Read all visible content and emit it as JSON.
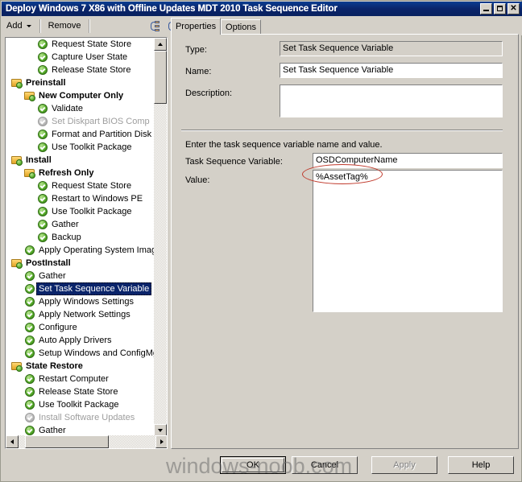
{
  "window": {
    "title": "Deploy Windows 7 X86 with Offline Updates MDT 2010 Task Sequence Editor",
    "minimize_label": "_",
    "maximize_label": "",
    "close_label": "✕"
  },
  "toolbar": {
    "add_label": "Add",
    "remove_label": "Remove",
    "move_up_icon": "move-up-icon",
    "move_down_icon": "move-down-icon"
  },
  "tree": {
    "items": [
      {
        "label": "Request State Store",
        "indent": 2,
        "icon": "check",
        "bold": false,
        "disabled": false,
        "selected": false
      },
      {
        "label": "Capture User State",
        "indent": 2,
        "icon": "check",
        "bold": false,
        "disabled": false,
        "selected": false
      },
      {
        "label": "Release State Store",
        "indent": 2,
        "icon": "check",
        "bold": false,
        "disabled": false,
        "selected": false
      },
      {
        "label": "Preinstall",
        "indent": 0,
        "icon": "folder",
        "bold": true,
        "disabled": false,
        "selected": false
      },
      {
        "label": "New Computer Only",
        "indent": 1,
        "icon": "folder",
        "bold": true,
        "disabled": false,
        "selected": false
      },
      {
        "label": "Validate",
        "indent": 2,
        "icon": "check",
        "bold": false,
        "disabled": false,
        "selected": false
      },
      {
        "label": "Set Diskpart BIOS Comp",
        "indent": 2,
        "icon": "check",
        "bold": false,
        "disabled": true,
        "selected": false
      },
      {
        "label": "Format and Partition Disk",
        "indent": 2,
        "icon": "check",
        "bold": false,
        "disabled": false,
        "selected": false
      },
      {
        "label": "Use Toolkit Package",
        "indent": 2,
        "icon": "check",
        "bold": false,
        "disabled": false,
        "selected": false
      },
      {
        "label": "Install",
        "indent": 0,
        "icon": "folder",
        "bold": true,
        "disabled": false,
        "selected": false
      },
      {
        "label": "Refresh Only",
        "indent": 1,
        "icon": "folder",
        "bold": true,
        "disabled": false,
        "selected": false
      },
      {
        "label": "Request State Store",
        "indent": 2,
        "icon": "check",
        "bold": false,
        "disabled": false,
        "selected": false
      },
      {
        "label": "Restart to Windows PE",
        "indent": 2,
        "icon": "check",
        "bold": false,
        "disabled": false,
        "selected": false
      },
      {
        "label": "Use Toolkit Package",
        "indent": 2,
        "icon": "check",
        "bold": false,
        "disabled": false,
        "selected": false
      },
      {
        "label": "Gather",
        "indent": 2,
        "icon": "check",
        "bold": false,
        "disabled": false,
        "selected": false
      },
      {
        "label": "Backup",
        "indent": 2,
        "icon": "check",
        "bold": false,
        "disabled": false,
        "selected": false
      },
      {
        "label": "Apply Operating System Image",
        "indent": 1,
        "icon": "check",
        "bold": false,
        "disabled": false,
        "selected": false
      },
      {
        "label": "PostInstall",
        "indent": 0,
        "icon": "folder",
        "bold": true,
        "disabled": false,
        "selected": false
      },
      {
        "label": "Gather",
        "indent": 1,
        "icon": "check",
        "bold": false,
        "disabled": false,
        "selected": false
      },
      {
        "label": "Set Task Sequence Variable",
        "indent": 1,
        "icon": "check",
        "bold": false,
        "disabled": false,
        "selected": true
      },
      {
        "label": "Apply Windows Settings",
        "indent": 1,
        "icon": "check",
        "bold": false,
        "disabled": false,
        "selected": false
      },
      {
        "label": "Apply Network Settings",
        "indent": 1,
        "icon": "check",
        "bold": false,
        "disabled": false,
        "selected": false
      },
      {
        "label": "Configure",
        "indent": 1,
        "icon": "check",
        "bold": false,
        "disabled": false,
        "selected": false
      },
      {
        "label": "Auto Apply Drivers",
        "indent": 1,
        "icon": "check",
        "bold": false,
        "disabled": false,
        "selected": false
      },
      {
        "label": "Setup Windows and ConfigMgr",
        "indent": 1,
        "icon": "check",
        "bold": false,
        "disabled": false,
        "selected": false
      },
      {
        "label": "State Restore",
        "indent": 0,
        "icon": "folder",
        "bold": true,
        "disabled": false,
        "selected": false
      },
      {
        "label": "Restart Computer",
        "indent": 1,
        "icon": "check",
        "bold": false,
        "disabled": false,
        "selected": false
      },
      {
        "label": "Release State Store",
        "indent": 1,
        "icon": "check",
        "bold": false,
        "disabled": false,
        "selected": false
      },
      {
        "label": "Use Toolkit Package",
        "indent": 1,
        "icon": "check",
        "bold": false,
        "disabled": false,
        "selected": false
      },
      {
        "label": "Install Software Updates",
        "indent": 1,
        "icon": "check",
        "bold": false,
        "disabled": true,
        "selected": false
      },
      {
        "label": "Gather",
        "indent": 1,
        "icon": "check",
        "bold": false,
        "disabled": false,
        "selected": false
      }
    ]
  },
  "tabs": [
    {
      "label": "Properties",
      "active": true
    },
    {
      "label": "Options",
      "active": false
    }
  ],
  "properties": {
    "type_label": "Type:",
    "type_value": "Set Task Sequence Variable",
    "name_label": "Name:",
    "name_value": "Set Task Sequence Variable",
    "description_label": "Description:",
    "description_value": "",
    "instruction": "Enter the task sequence variable name and value.",
    "variable_label": "Task Sequence Variable:",
    "variable_value": "OSDComputerName",
    "value_label": "Value:",
    "value_value": "%AssetTag%"
  },
  "annotation": {
    "color": "#c0392b",
    "target": "%AssetTag%"
  },
  "buttons": {
    "ok": "OK",
    "cancel": "Cancel",
    "apply": "Apply",
    "help": "Help"
  },
  "watermark": {
    "text": "windows-noob.com"
  }
}
